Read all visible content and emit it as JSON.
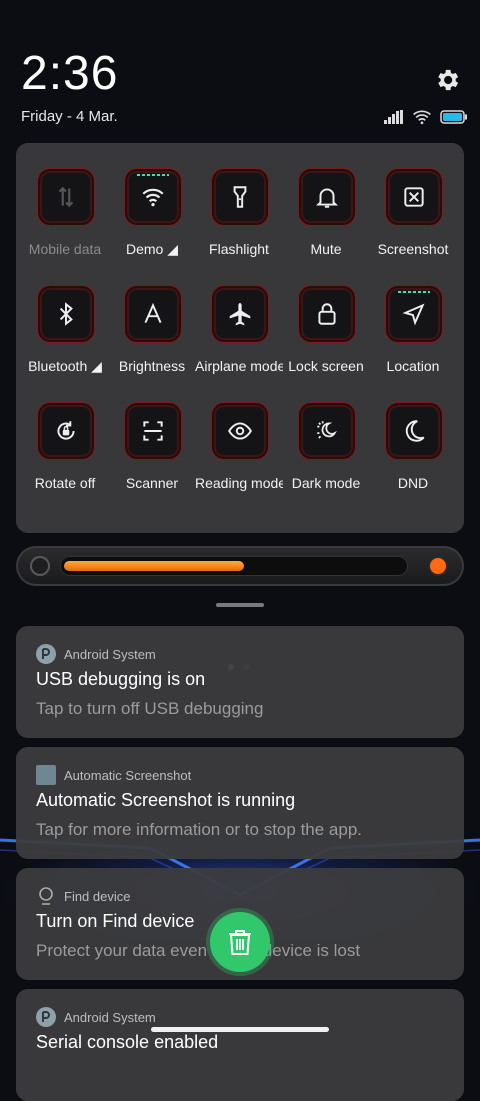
{
  "status": {
    "time": "2:36",
    "date": "Friday - 4 Mar."
  },
  "quick_settings": {
    "tiles": [
      {
        "label": "Mobile data",
        "icon": "mobile-data-icon",
        "active": false,
        "dim": true
      },
      {
        "label": "Demo ◢",
        "icon": "wifi-icon",
        "active": true,
        "dim": false
      },
      {
        "label": "Flashlight",
        "icon": "flashlight-icon",
        "active": false,
        "dim": false
      },
      {
        "label": "Mute",
        "icon": "bell-icon",
        "active": false,
        "dim": false
      },
      {
        "label": "Screenshot",
        "icon": "screenshot-icon",
        "active": false,
        "dim": false
      },
      {
        "label": "Bluetooth ◢",
        "icon": "bluetooth-icon",
        "active": false,
        "dim": false
      },
      {
        "label": "Brightness",
        "icon": "brightness-icon",
        "active": false,
        "dim": false
      },
      {
        "label": "Airplane mode",
        "icon": "airplane-icon",
        "active": false,
        "dim": false
      },
      {
        "label": "Lock screen",
        "icon": "lock-icon",
        "active": false,
        "dim": false
      },
      {
        "label": "Location",
        "icon": "location-icon",
        "active": true,
        "dim": false
      },
      {
        "label": "Rotate off",
        "icon": "rotate-lock-icon",
        "active": false,
        "dim": false
      },
      {
        "label": "Scanner",
        "icon": "scanner-icon",
        "active": false,
        "dim": false
      },
      {
        "label": "Reading mode",
        "icon": "eye-icon",
        "active": false,
        "dim": false
      },
      {
        "label": "Dark mode",
        "icon": "dark-mode-icon",
        "active": false,
        "dim": false
      },
      {
        "label": "DND",
        "icon": "moon-icon",
        "active": false,
        "dim": false
      }
    ],
    "page_count": 2,
    "current_page": 1
  },
  "brightness": {
    "level": 0.53
  },
  "notifications": [
    {
      "app": "Android System",
      "icon": "android-system-icon",
      "title": "USB debugging is on",
      "text": "Tap to turn off USB debugging"
    },
    {
      "app": "Automatic Screenshot",
      "icon": "automatic-screenshot-icon",
      "title": "Automatic Screenshot is running",
      "text": "Tap for more information or to stop the app."
    },
    {
      "app": "Find device",
      "icon": "find-device-icon",
      "title": "Turn on Find device",
      "text": "Protect your data even if your device is lost"
    },
    {
      "app": "Android System",
      "icon": "android-system-icon",
      "title": "Serial console enabled",
      "text": ""
    }
  ],
  "colors": {
    "accent_green": "#30c86a",
    "slider_orange": "#ff8a1f",
    "tile_border_red": "#7a1c1c",
    "active_indicator": "#38e6b4"
  }
}
